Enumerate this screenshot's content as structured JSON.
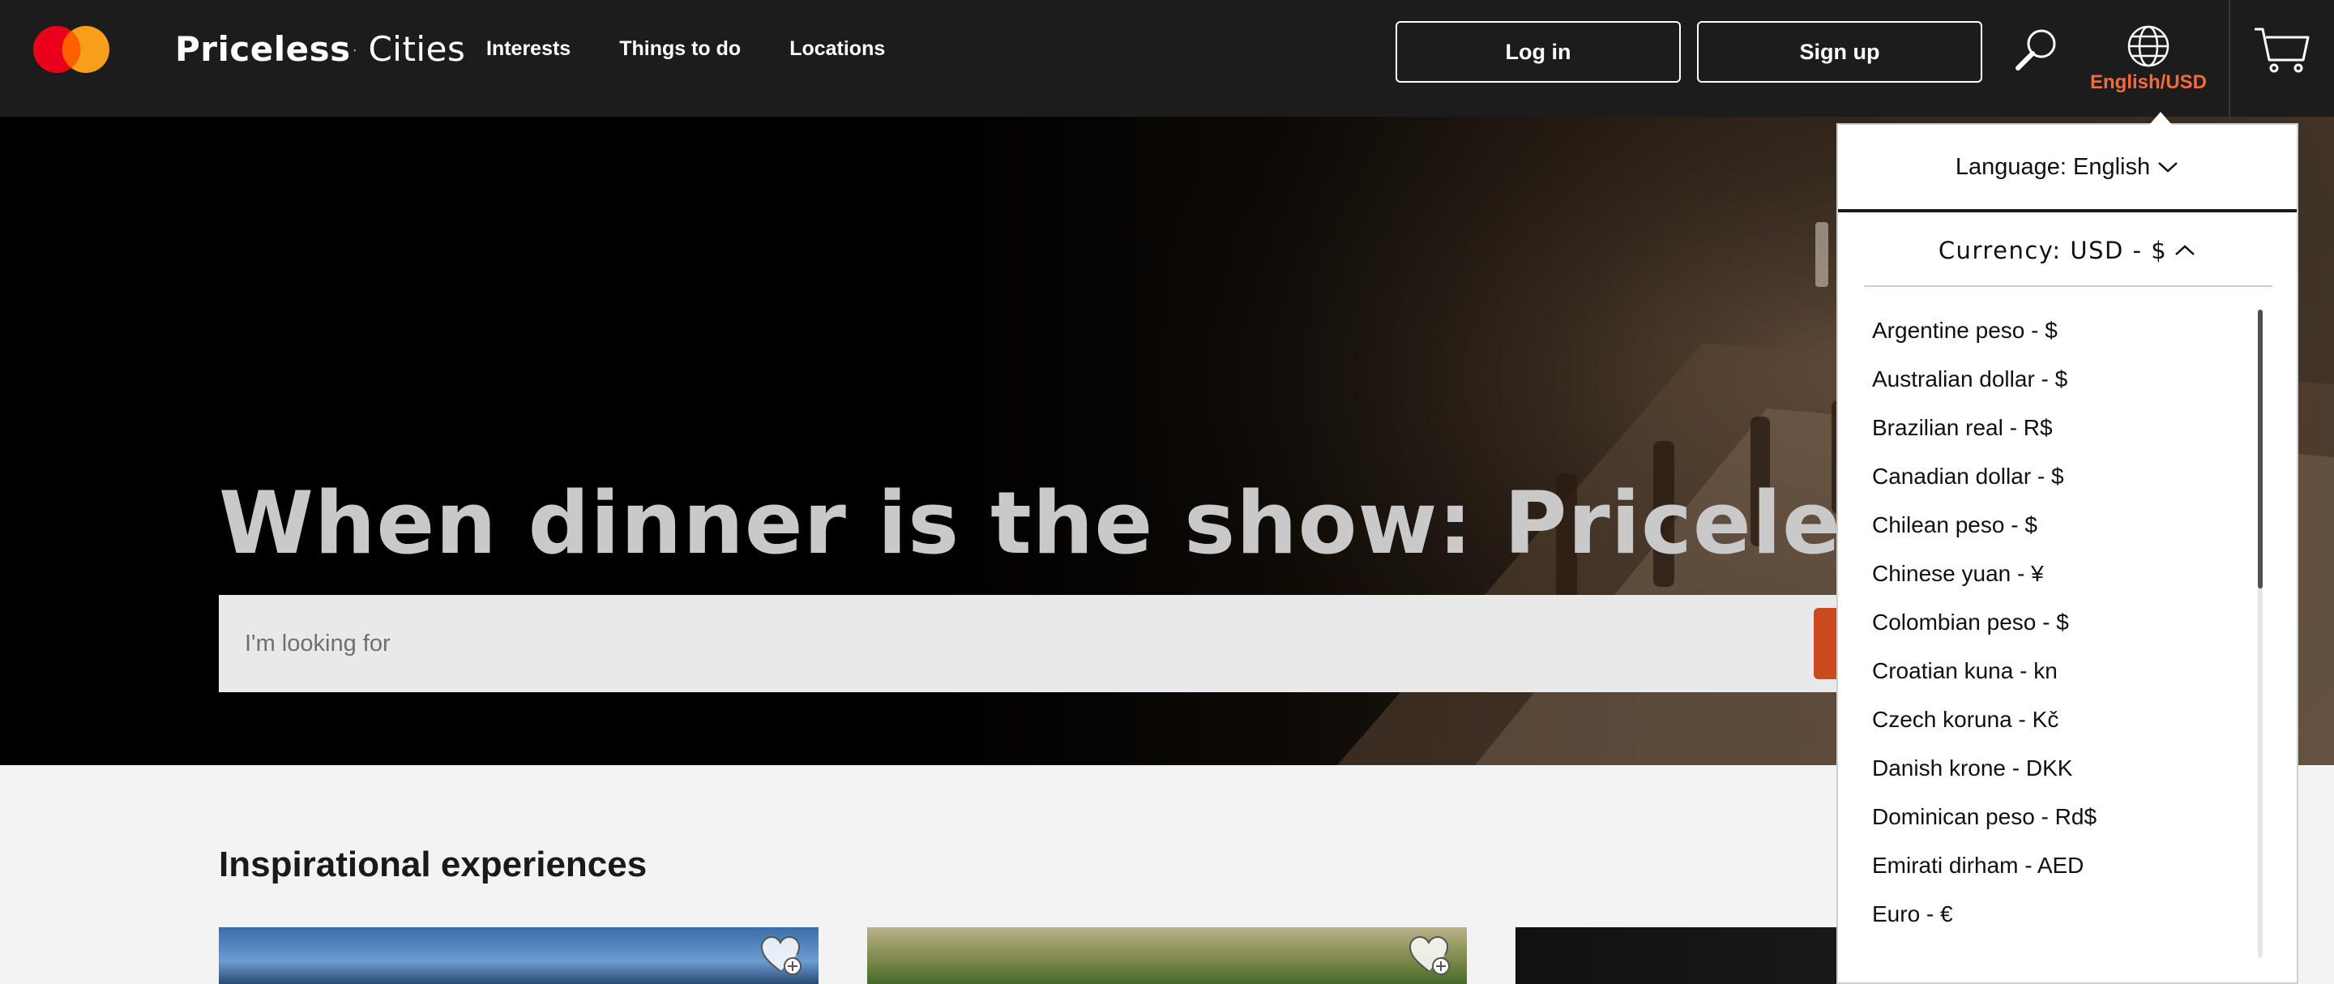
{
  "header": {
    "brand_bold": "Priceless",
    "brand_mark": "·",
    "brand_rest": "Cities",
    "nav": [
      "Interests",
      "Things to do",
      "Locations"
    ],
    "login_label": "Log in",
    "signup_label": "Sign up",
    "locale_label": "English/USD",
    "accent_color": "#f26b3a",
    "icons": [
      "mastercard-logo",
      "search-icon",
      "globe-icon",
      "cart-icon"
    ]
  },
  "hero": {
    "title": "When dinner is the show: Priceless",
    "search_placeholder": "I'm looking for"
  },
  "content": {
    "section_title": "Inspirational experiences"
  },
  "locale_dropdown": {
    "language_label": "Language: English",
    "currency_label": "Currency: USD - $",
    "currencies": [
      "Argentine peso - $",
      "Australian dollar - $",
      "Brazilian real - R$",
      "Canadian dollar - $",
      "Chilean peso - $",
      "Chinese yuan - ¥",
      "Colombian peso - $",
      "Croatian kuna - kn",
      "Czech koruna - Kč",
      "Danish krone - DKK",
      "Dominican peso - Rd$",
      "Emirati dirham - AED",
      "Euro - €"
    ]
  }
}
